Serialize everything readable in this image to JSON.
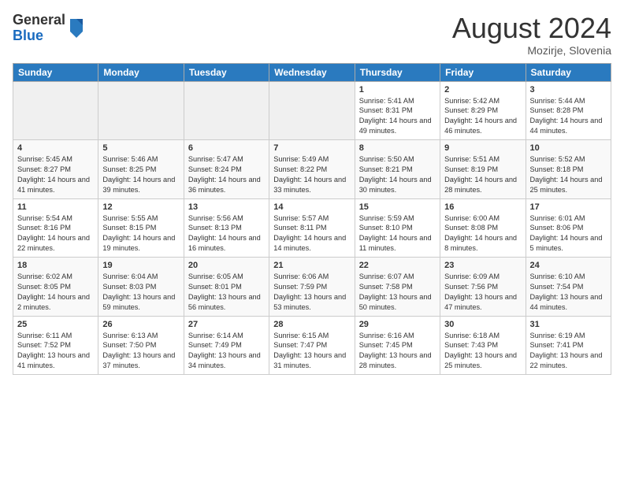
{
  "logo": {
    "general": "General",
    "blue": "Blue"
  },
  "title": "August 2024",
  "location": "Mozirje, Slovenia",
  "days_of_week": [
    "Sunday",
    "Monday",
    "Tuesday",
    "Wednesday",
    "Thursday",
    "Friday",
    "Saturday"
  ],
  "weeks": [
    [
      {
        "num": "",
        "info": ""
      },
      {
        "num": "",
        "info": ""
      },
      {
        "num": "",
        "info": ""
      },
      {
        "num": "",
        "info": ""
      },
      {
        "num": "1",
        "info": "Sunrise: 5:41 AM\nSunset: 8:31 PM\nDaylight: 14 hours and 49 minutes."
      },
      {
        "num": "2",
        "info": "Sunrise: 5:42 AM\nSunset: 8:29 PM\nDaylight: 14 hours and 46 minutes."
      },
      {
        "num": "3",
        "info": "Sunrise: 5:44 AM\nSunset: 8:28 PM\nDaylight: 14 hours and 44 minutes."
      }
    ],
    [
      {
        "num": "4",
        "info": "Sunrise: 5:45 AM\nSunset: 8:27 PM\nDaylight: 14 hours and 41 minutes."
      },
      {
        "num": "5",
        "info": "Sunrise: 5:46 AM\nSunset: 8:25 PM\nDaylight: 14 hours and 39 minutes."
      },
      {
        "num": "6",
        "info": "Sunrise: 5:47 AM\nSunset: 8:24 PM\nDaylight: 14 hours and 36 minutes."
      },
      {
        "num": "7",
        "info": "Sunrise: 5:49 AM\nSunset: 8:22 PM\nDaylight: 14 hours and 33 minutes."
      },
      {
        "num": "8",
        "info": "Sunrise: 5:50 AM\nSunset: 8:21 PM\nDaylight: 14 hours and 30 minutes."
      },
      {
        "num": "9",
        "info": "Sunrise: 5:51 AM\nSunset: 8:19 PM\nDaylight: 14 hours and 28 minutes."
      },
      {
        "num": "10",
        "info": "Sunrise: 5:52 AM\nSunset: 8:18 PM\nDaylight: 14 hours and 25 minutes."
      }
    ],
    [
      {
        "num": "11",
        "info": "Sunrise: 5:54 AM\nSunset: 8:16 PM\nDaylight: 14 hours and 22 minutes."
      },
      {
        "num": "12",
        "info": "Sunrise: 5:55 AM\nSunset: 8:15 PM\nDaylight: 14 hours and 19 minutes."
      },
      {
        "num": "13",
        "info": "Sunrise: 5:56 AM\nSunset: 8:13 PM\nDaylight: 14 hours and 16 minutes."
      },
      {
        "num": "14",
        "info": "Sunrise: 5:57 AM\nSunset: 8:11 PM\nDaylight: 14 hours and 14 minutes."
      },
      {
        "num": "15",
        "info": "Sunrise: 5:59 AM\nSunset: 8:10 PM\nDaylight: 14 hours and 11 minutes."
      },
      {
        "num": "16",
        "info": "Sunrise: 6:00 AM\nSunset: 8:08 PM\nDaylight: 14 hours and 8 minutes."
      },
      {
        "num": "17",
        "info": "Sunrise: 6:01 AM\nSunset: 8:06 PM\nDaylight: 14 hours and 5 minutes."
      }
    ],
    [
      {
        "num": "18",
        "info": "Sunrise: 6:02 AM\nSunset: 8:05 PM\nDaylight: 14 hours and 2 minutes."
      },
      {
        "num": "19",
        "info": "Sunrise: 6:04 AM\nSunset: 8:03 PM\nDaylight: 13 hours and 59 minutes."
      },
      {
        "num": "20",
        "info": "Sunrise: 6:05 AM\nSunset: 8:01 PM\nDaylight: 13 hours and 56 minutes."
      },
      {
        "num": "21",
        "info": "Sunrise: 6:06 AM\nSunset: 7:59 PM\nDaylight: 13 hours and 53 minutes."
      },
      {
        "num": "22",
        "info": "Sunrise: 6:07 AM\nSunset: 7:58 PM\nDaylight: 13 hours and 50 minutes."
      },
      {
        "num": "23",
        "info": "Sunrise: 6:09 AM\nSunset: 7:56 PM\nDaylight: 13 hours and 47 minutes."
      },
      {
        "num": "24",
        "info": "Sunrise: 6:10 AM\nSunset: 7:54 PM\nDaylight: 13 hours and 44 minutes."
      }
    ],
    [
      {
        "num": "25",
        "info": "Sunrise: 6:11 AM\nSunset: 7:52 PM\nDaylight: 13 hours and 41 minutes."
      },
      {
        "num": "26",
        "info": "Sunrise: 6:13 AM\nSunset: 7:50 PM\nDaylight: 13 hours and 37 minutes."
      },
      {
        "num": "27",
        "info": "Sunrise: 6:14 AM\nSunset: 7:49 PM\nDaylight: 13 hours and 34 minutes."
      },
      {
        "num": "28",
        "info": "Sunrise: 6:15 AM\nSunset: 7:47 PM\nDaylight: 13 hours and 31 minutes."
      },
      {
        "num": "29",
        "info": "Sunrise: 6:16 AM\nSunset: 7:45 PM\nDaylight: 13 hours and 28 minutes."
      },
      {
        "num": "30",
        "info": "Sunrise: 6:18 AM\nSunset: 7:43 PM\nDaylight: 13 hours and 25 minutes."
      },
      {
        "num": "31",
        "info": "Sunrise: 6:19 AM\nSunset: 7:41 PM\nDaylight: 13 hours and 22 minutes."
      }
    ]
  ]
}
